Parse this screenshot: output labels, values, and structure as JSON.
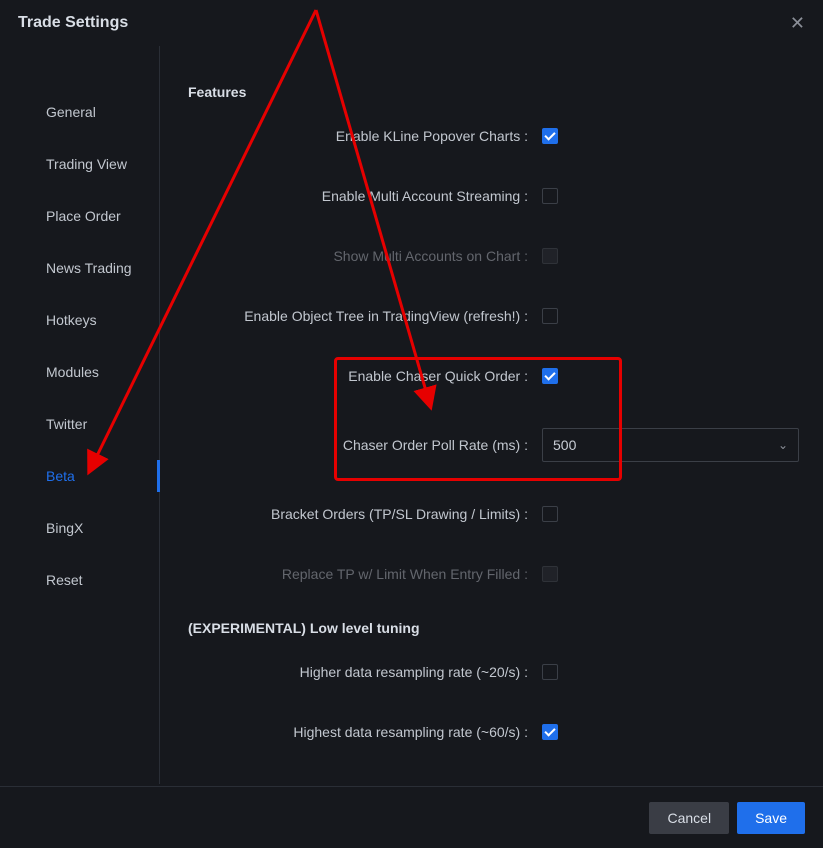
{
  "header": {
    "title": "Trade Settings"
  },
  "sidebar": {
    "items": [
      {
        "label": "General"
      },
      {
        "label": "Trading View"
      },
      {
        "label": "Place Order"
      },
      {
        "label": "News Trading"
      },
      {
        "label": "Hotkeys"
      },
      {
        "label": "Modules"
      },
      {
        "label": "Twitter"
      },
      {
        "label": "Beta"
      },
      {
        "label": "BingX"
      },
      {
        "label": "Reset"
      }
    ]
  },
  "sections": {
    "features_title": "Features",
    "tuning_title": "(EXPERIMENTAL) Low level tuning"
  },
  "fields": {
    "kline_label": "Enable KLine Popover Charts :",
    "streaming_label": "Enable Multi Account Streaming :",
    "show_multi_label": "Show Multi Accounts on Chart :",
    "object_tree_label": "Enable Object Tree in TradingView (refresh!) :",
    "chaser_quick_label": "Enable Chaser Quick Order :",
    "chaser_poll_label": "Chaser Order Poll Rate (ms) :",
    "chaser_poll_value": "500",
    "bracket_label": "Bracket Orders (TP/SL Drawing / Limits) :",
    "replace_tp_label": "Replace TP w/ Limit When Entry Filled :",
    "higher_resample_label": "Higher data resampling rate (~20/s) :",
    "highest_resample_label": "Highest data resampling rate (~60/s) :"
  },
  "footer": {
    "cancel_label": "Cancel",
    "save_label": "Save"
  }
}
